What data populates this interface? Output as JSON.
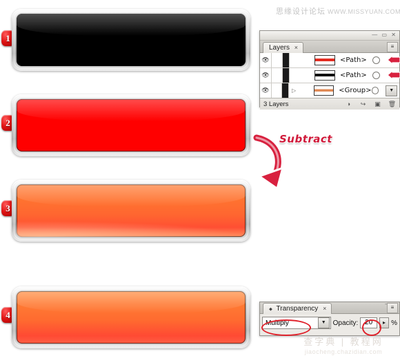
{
  "watermarks": {
    "top_cn": "思缘设计论坛",
    "top_url": "WWW.MISSYUAN.COM",
    "bottom_cn": "查字典 | 教程网",
    "bottom_url": "jiaocheng.chazidian.com"
  },
  "steps": [
    {
      "badge": "1",
      "name": "black-button",
      "fill": "#000000"
    },
    {
      "badge": "2",
      "name": "red-button",
      "fill": "#ff0000"
    },
    {
      "badge": "3",
      "name": "orange-gradient-button",
      "fill": "#ff6a2a"
    },
    {
      "badge": "4",
      "name": "multiply-orange-button",
      "fill": "#ff7030"
    }
  ],
  "annotation": {
    "label": "Subtract",
    "arrow_icon": "curved-arrow-icon",
    "color": "#d01a3a"
  },
  "layers_panel": {
    "title": "Layers",
    "close_icon": "×",
    "menu_icon": "≡",
    "minimize_icon": "—",
    "maximize_icon": "▭",
    "footer_count": "3 Layers",
    "footer_icons": [
      "make-clipping-mask-icon",
      "create-sublayer-icon",
      "new-layer-icon",
      "delete-layer-icon"
    ],
    "rows": [
      {
        "visible_icon": "eye-icon",
        "name": "<Path>",
        "thumb_color": "#e32b20",
        "has_arrow": true,
        "expander": false
      },
      {
        "visible_icon": "eye-icon",
        "name": "<Path>",
        "thumb_color": "#101010",
        "has_arrow": true,
        "expander": false
      },
      {
        "visible_icon": "eye-icon",
        "name": "<Group>",
        "thumb_color": "#e08a55",
        "has_arrow": false,
        "expander": true
      }
    ]
  },
  "transparency_panel": {
    "title": "Transparency",
    "options_icon": "⬥",
    "close_icon": "×",
    "menu_icon": "≡",
    "blend_mode": "Multiply",
    "blend_dropdown_icon": "chevron-down-icon",
    "opacity_label": "Opacity:",
    "opacity_value": "20",
    "opacity_unit": "%",
    "opacity_stepper_icon": "chevron-right-icon",
    "highlight_color": "#e0202a"
  }
}
